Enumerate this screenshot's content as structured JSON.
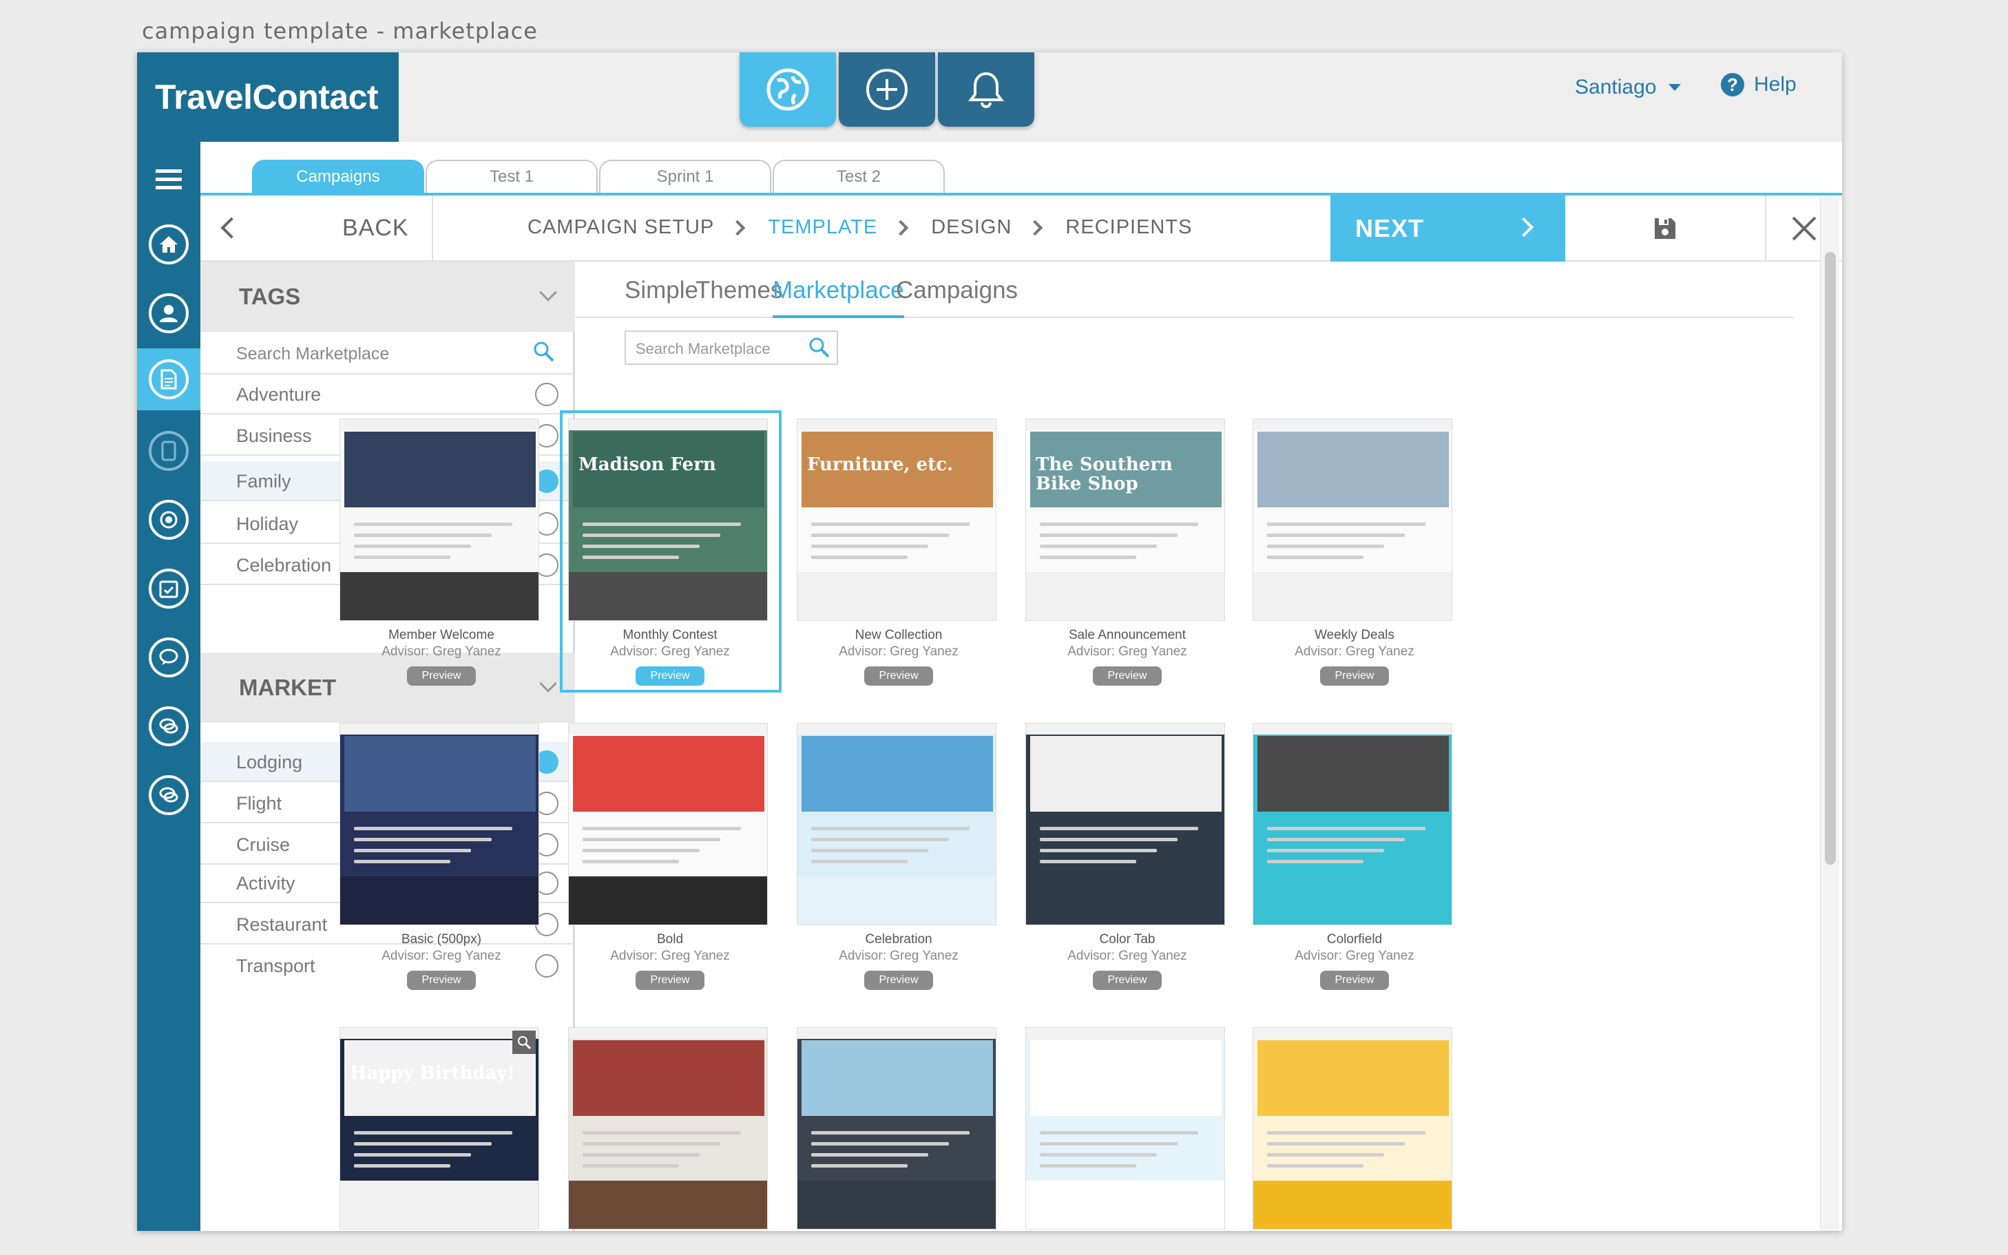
{
  "window": {
    "title": "campaign template - marketplace"
  },
  "brand": {
    "name": "TravelContact"
  },
  "top_actions": [
    {
      "icon": "globe-icon",
      "active": true
    },
    {
      "icon": "plus-circle-icon",
      "active": false
    },
    {
      "icon": "bell-icon",
      "active": false
    }
  ],
  "user": {
    "name": "Santiago"
  },
  "help": {
    "label": "Help"
  },
  "rail": {
    "items": [
      "menu-icon",
      "home-icon",
      "user-icon",
      "document-icon",
      "tablet-icon",
      "target-icon",
      "calendar-icon",
      "chat-icon",
      "chat-double-icon",
      "chat-double-icon"
    ]
  },
  "tabs": [
    {
      "label": "Campaigns",
      "active": true
    },
    {
      "label": "Test 1",
      "active": false
    },
    {
      "label": "Sprint 1",
      "active": false
    },
    {
      "label": "Test 2",
      "active": false
    }
  ],
  "nav": {
    "back_label": "BACK",
    "steps": [
      {
        "label": "CAMPAIGN SETUP",
        "active": false
      },
      {
        "label": "TEMPLATE",
        "active": true
      },
      {
        "label": "DESIGN",
        "active": false
      },
      {
        "label": "RECIPIENTS",
        "active": false
      }
    ],
    "next_label": "NEXT"
  },
  "sidebar": {
    "tags": {
      "title": "TAGS",
      "search_placeholder": "Search Marketplace",
      "options": [
        {
          "label": "Adventure",
          "selected": false
        },
        {
          "label": "Business",
          "selected": false
        },
        {
          "label": "Family",
          "selected": true
        },
        {
          "label": "Holiday",
          "selected": false
        },
        {
          "label": "Celebration",
          "selected": false
        }
      ]
    },
    "market": {
      "title": "MARKET",
      "options": [
        {
          "label": "Lodging",
          "selected": true
        },
        {
          "label": "Flight",
          "selected": false
        },
        {
          "label": "Cruise",
          "selected": false
        },
        {
          "label": "Activity",
          "selected": false
        },
        {
          "label": "Restaurant",
          "selected": false
        },
        {
          "label": "Transport",
          "selected": false
        }
      ]
    }
  },
  "content": {
    "tabs": [
      {
        "label": "Simple",
        "active": false
      },
      {
        "label": "Themes",
        "active": false
      },
      {
        "label": "Marketplace",
        "active": true
      },
      {
        "label": "Campaigns",
        "active": false
      }
    ],
    "search_placeholder": "Search Marketplace",
    "preview_label": "Preview",
    "templates": [
      {
        "name": "Member Welcome",
        "advisor": "Advisor: Greg Yanez",
        "selected": false,
        "bg": "#f7f7f7",
        "img": "#33415f",
        "bottom": "#3a3a3a",
        "title": ""
      },
      {
        "name": "Monthly Contest",
        "advisor": "Advisor: Greg Yanez",
        "selected": true,
        "bg": "#4e7e6c",
        "img": "#3b6b5a",
        "bottom": "#4c4c4c",
        "title": "Madison Fern"
      },
      {
        "name": "New Collection",
        "advisor": "Advisor: Greg Yanez",
        "selected": false,
        "bg": "#fafafa",
        "img": "#c98a50",
        "bottom": "#f1f1f1",
        "title": "Furniture, etc."
      },
      {
        "name": "Sale Announcement",
        "advisor": "Advisor: Greg Yanez",
        "selected": false,
        "bg": "#fafafa",
        "img": "#6f9ca0",
        "bottom": "#f1f1f1",
        "title": "The Southern Bike Shop"
      },
      {
        "name": "Weekly Deals",
        "advisor": "Advisor: Greg Yanez",
        "selected": false,
        "bg": "#fafafa",
        "img": "#9fb4c6",
        "bottom": "#f1f1f1",
        "title": ""
      },
      {
        "name": "Basic (500px)",
        "advisor": "Advisor: Greg Yanez",
        "selected": false,
        "bg": "#27315a",
        "img": "#3e5b8c",
        "bottom": "#1f2540",
        "title": ""
      },
      {
        "name": "Bold",
        "advisor": "Advisor: Greg Yanez",
        "selected": false,
        "bg": "#fafafa",
        "img": "#e0463f",
        "bottom": "#2a2a2a",
        "title": ""
      },
      {
        "name": "Celebration",
        "advisor": "Advisor: Greg Yanez",
        "selected": false,
        "bg": "#dceef7",
        "img": "#5aa6d6",
        "bottom": "#e6f2f9",
        "title": ""
      },
      {
        "name": "Color Tab",
        "advisor": "Advisor: Greg Yanez",
        "selected": false,
        "bg": "#2f3b48",
        "img": "#eeeeee",
        "bottom": "#2f3b48",
        "title": ""
      },
      {
        "name": "Colorfield",
        "advisor": "Advisor: Greg Yanez",
        "selected": false,
        "bg": "#39c2d4",
        "img": "#4a4a4a",
        "bottom": "#39c2d4",
        "title": ""
      },
      {
        "name": "",
        "advisor": "",
        "selected": false,
        "bg": "#1e2a44",
        "img": "#f2f2f2",
        "bottom": "#f2f2f2",
        "title": "Happy Birthday!"
      },
      {
        "name": "",
        "advisor": "",
        "selected": false,
        "bg": "#e8e4de",
        "img": "#a04038",
        "bottom": "#6c4a38",
        "title": ""
      },
      {
        "name": "",
        "advisor": "",
        "selected": false,
        "bg": "#3c4450",
        "img": "#9bc6df",
        "bottom": "#333b46",
        "title": ""
      },
      {
        "name": "",
        "advisor": "",
        "selected": false,
        "bg": "#e5f4fb",
        "img": "#ffffff",
        "bottom": "#ffffff",
        "title": ""
      },
      {
        "name": "",
        "advisor": "",
        "selected": false,
        "bg": "#fff3d6",
        "img": "#f6c544",
        "bottom": "#f1b820",
        "title": ""
      }
    ]
  },
  "colors": {
    "accent": "#4bbfea",
    "brand": "#1b6e93"
  }
}
